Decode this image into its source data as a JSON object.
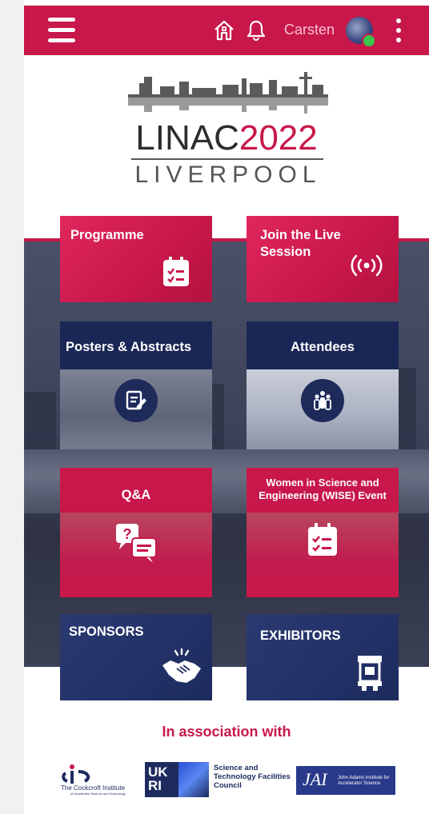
{
  "header": {
    "username": "Carsten",
    "icons": [
      "menu-icon",
      "home-icon",
      "bell-icon",
      "avatar",
      "more-vertical-icon"
    ]
  },
  "logo": {
    "name_part1": "LINAC",
    "name_part2": "2022",
    "city": "LIVERPOOL"
  },
  "tiles": [
    {
      "label": "Programme",
      "icon": "checklist-icon"
    },
    {
      "label": "Join the Live Session",
      "icon": "broadcast-icon"
    },
    {
      "label": "Posters & Abstracts",
      "icon": "edit-document-icon"
    },
    {
      "label": "Attendees",
      "icon": "people-icon"
    },
    {
      "label": "Q&A",
      "icon": "question-chat-icon"
    },
    {
      "label": "Women in Science and Engineering (WISE) Event",
      "icon": "checklist-icon"
    },
    {
      "label": "SPONSORS",
      "icon": "handshake-icon"
    },
    {
      "label": "EXHIBITORS",
      "icon": "booth-icon"
    }
  ],
  "footer": {
    "association_text": "In association with",
    "partners": [
      {
        "name": "The Cockcroft Institute",
        "tagline": "of Accelerator Science and Technology"
      },
      {
        "name": "UK RI"
      },
      {
        "name": "Science and Technology Facilities Council"
      },
      {
        "name": "JAI",
        "tagline": "John Adams Institute for Accelerator Science"
      }
    ]
  },
  "colors": {
    "brand_red": "#c8174a",
    "navy": "#1d2b5e"
  }
}
